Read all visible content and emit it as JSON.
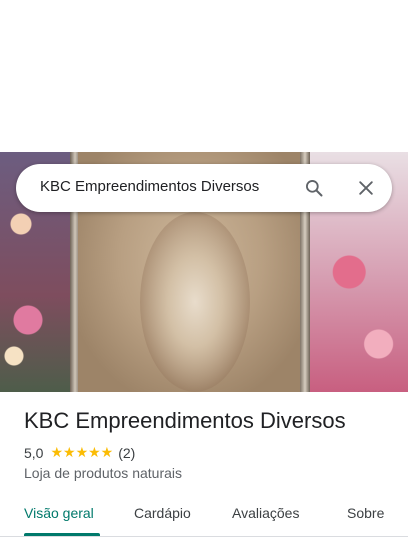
{
  "search": {
    "query": "KBC Empreendimentos Diversos"
  },
  "place": {
    "title": "KBC Empreendimentos Diversos",
    "rating": "5,0",
    "stars": "★★★★★",
    "review_count": "(2)",
    "category": "Loja de produtos naturais"
  },
  "tabs": [
    {
      "label": "Visão geral",
      "active": true
    },
    {
      "label": "Cardápio",
      "active": false
    },
    {
      "label": "Avaliações",
      "active": false
    },
    {
      "label": "Sobre",
      "active": false
    }
  ],
  "colors": {
    "accent": "#00796b",
    "star": "#fbbc04"
  },
  "icons": {
    "search": "search-icon",
    "close": "close-icon"
  }
}
